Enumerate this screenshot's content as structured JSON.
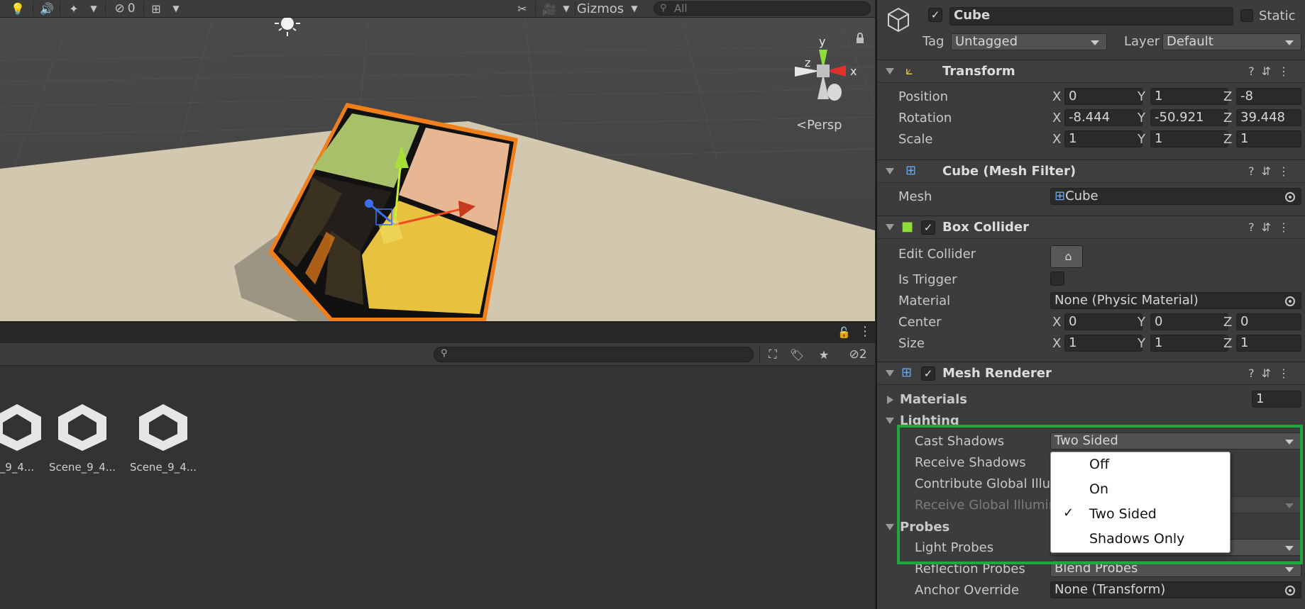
{
  "scene_toolbar": {
    "hidden_count": "0",
    "gizmos_label": "Gizmos",
    "search_placeholder": "All"
  },
  "scene_view": {
    "projection_label": "Persp",
    "axis_y": "y",
    "axis_x": "x",
    "axis_z": "z",
    "colors": {
      "sky": "#474747",
      "ground": "#d2c8b0",
      "selection": "#f07f1a"
    }
  },
  "project": {
    "hidden_count": "2",
    "assets": [
      {
        "label": "_9_4..."
      },
      {
        "label": "Scene_9_4..."
      },
      {
        "label": "Scene_9_4..."
      }
    ]
  },
  "inspector": {
    "object": {
      "name": "Cube",
      "static_label": "Static",
      "tag_label": "Tag",
      "tag_value": "Untagged",
      "layer_label": "Layer",
      "layer_value": "Default"
    },
    "transform": {
      "title": "Transform",
      "rows": [
        {
          "label": "Position",
          "x": "0",
          "y": "1",
          "z": "-8"
        },
        {
          "label": "Rotation",
          "x": "-8.444",
          "y": "-50.921",
          "z": "39.448"
        },
        {
          "label": "Scale",
          "x": "1",
          "y": "1",
          "z": "1"
        }
      ]
    },
    "mesh_filter": {
      "title": "Cube (Mesh Filter)",
      "mesh_label": "Mesh",
      "mesh_value": "Cube"
    },
    "box_collider": {
      "title": "Box Collider",
      "edit_label": "Edit Collider",
      "trigger_label": "Is Trigger",
      "material_label": "Material",
      "material_value": "None (Physic Material)",
      "center_label": "Center",
      "center": {
        "x": "0",
        "y": "0",
        "z": "0"
      },
      "size_label": "Size",
      "size": {
        "x": "1",
        "y": "1",
        "z": "1"
      }
    },
    "mesh_renderer": {
      "title": "Mesh Renderer",
      "materials_label": "Materials",
      "materials_count": "1",
      "lighting_label": "Lighting",
      "cast_shadows_label": "Cast Shadows",
      "cast_shadows_value": "Two Sided",
      "receive_shadows_label": "Receive Shadows",
      "contribute_gi_label": "Contribute Global Illum",
      "receive_gi_label": "Receive Global Illumin",
      "probes_label": "Probes",
      "light_probes_label": "Light Probes",
      "reflection_probes_label": "Reflection Probes",
      "reflection_probes_value": "Blend Probes",
      "anchor_label": "Anchor Override",
      "anchor_value": "None (Transform)"
    },
    "cast_shadow_options": {
      "items": [
        "Off",
        "On",
        "Two Sided",
        "Shadows Only"
      ],
      "selected": "Two Sided",
      "check_glyph": "✓"
    },
    "highlight_color": "#1fa83c"
  }
}
